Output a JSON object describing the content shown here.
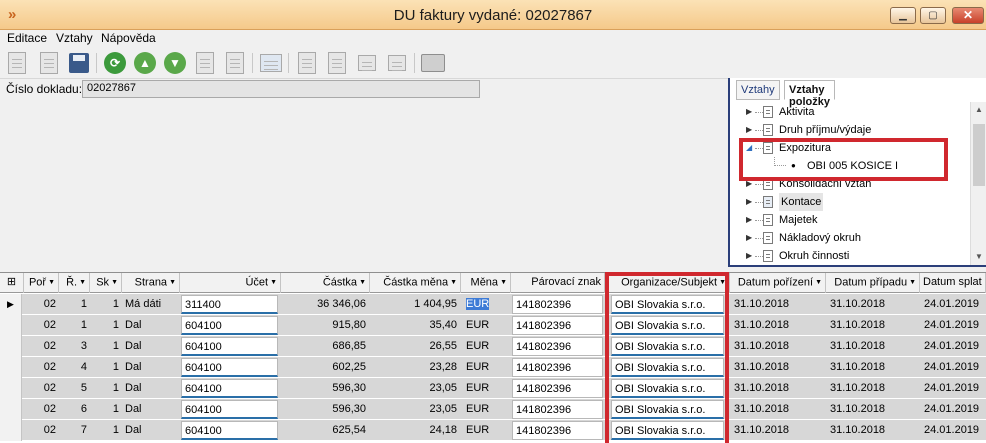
{
  "window": {
    "title": "DU faktury vydané: 02027867",
    "colors": {
      "titlebar": "#f5c98a",
      "accent": "#2b3f7a",
      "highlight": "#d0282e"
    }
  },
  "menu": [
    "Editace",
    "Vztahy",
    "Nápověda"
  ],
  "document": {
    "label": "Číslo dokladu:",
    "value": "02027867"
  },
  "panel": {
    "tabs": [
      "Vztahy",
      "Vztahy položky"
    ],
    "active_tab": "Vztahy položky",
    "tree": [
      {
        "label": "Aktivita"
      },
      {
        "label": "Druh příjmu/výdaje"
      },
      {
        "label": "Expozitura"
      },
      {
        "label": "OBI 005 KOSICE I"
      },
      {
        "label": "Konsolidační vztah"
      },
      {
        "label": "Kontace"
      },
      {
        "label": "Majetek"
      },
      {
        "label": "Nákladový okruh"
      },
      {
        "label": "Okruh činnosti"
      }
    ]
  },
  "grid": {
    "columns": [
      "Poř",
      "Ř.",
      "Sk",
      "Strana",
      "Účet",
      "Částka",
      "Částka měna",
      "Měna",
      "Párovací znak",
      "Organizace/Subjekt",
      "Datum pořízení",
      "Datum případu",
      "Datum splat"
    ],
    "rows": [
      [
        "02",
        "1",
        "1",
        "Má dáti",
        "311400",
        "36 346,06",
        "1 404,95",
        "EUR",
        "141802396",
        "OBI Slovakia s.r.o.",
        "31.10.2018",
        "31.10.2018",
        "24.01.2019"
      ],
      [
        "02",
        "1",
        "1",
        "Dal",
        "604100",
        "915,80",
        "35,40",
        "EUR",
        "141802396",
        "OBI Slovakia s.r.o.",
        "31.10.2018",
        "31.10.2018",
        "24.01.2019"
      ],
      [
        "02",
        "3",
        "1",
        "Dal",
        "604100",
        "686,85",
        "26,55",
        "EUR",
        "141802396",
        "OBI Slovakia s.r.o.",
        "31.10.2018",
        "31.10.2018",
        "24.01.2019"
      ],
      [
        "02",
        "4",
        "1",
        "Dal",
        "604100",
        "602,25",
        "23,28",
        "EUR",
        "141802396",
        "OBI Slovakia s.r.o.",
        "31.10.2018",
        "31.10.2018",
        "24.01.2019"
      ],
      [
        "02",
        "5",
        "1",
        "Dal",
        "604100",
        "596,30",
        "23,05",
        "EUR",
        "141802396",
        "OBI Slovakia s.r.o.",
        "31.10.2018",
        "31.10.2018",
        "24.01.2019"
      ],
      [
        "02",
        "6",
        "1",
        "Dal",
        "604100",
        "596,30",
        "23,05",
        "EUR",
        "141802396",
        "OBI Slovakia s.r.o.",
        "31.10.2018",
        "31.10.2018",
        "24.01.2019"
      ],
      [
        "02",
        "7",
        "1",
        "Dal",
        "604100",
        "625,54",
        "24,18",
        "EUR",
        "141802396",
        "OBI Slovakia s.r.o.",
        "31.10.2018",
        "31.10.2018",
        "24.01.2019"
      ]
    ]
  }
}
